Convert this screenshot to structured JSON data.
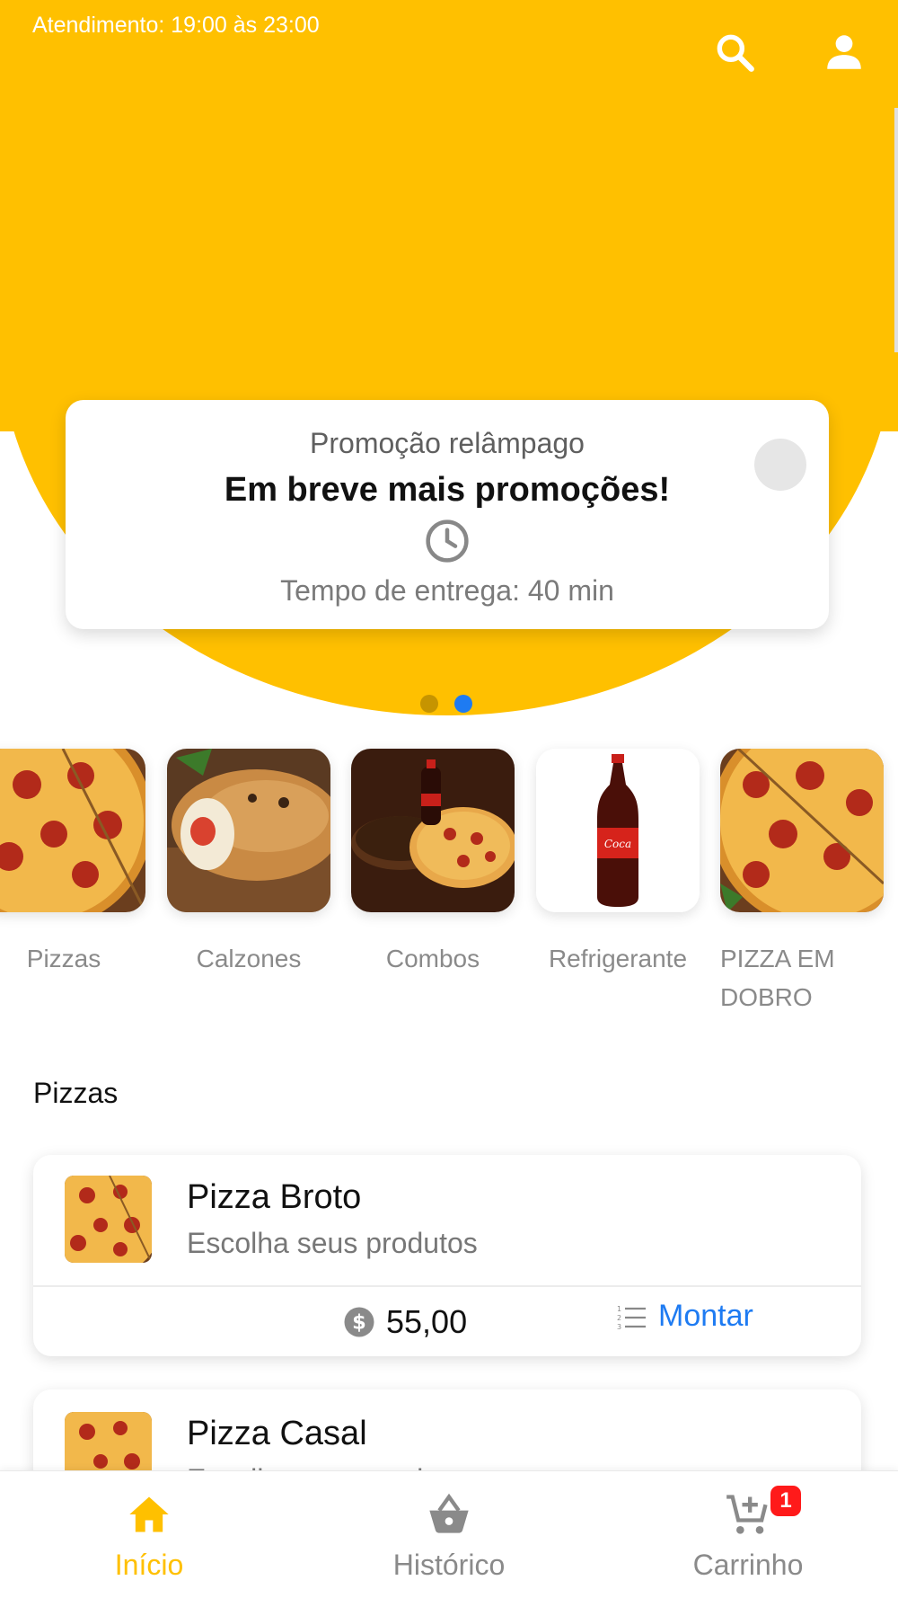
{
  "header": {
    "hours_text": "Atendimento: 19:00 às 23:00",
    "search_icon": "search-icon",
    "profile_icon": "user-icon"
  },
  "colors": {
    "brand_yellow": "#FFC000",
    "accent_blue": "#1E7BF2",
    "badge_red": "#FF1A1A"
  },
  "promo": {
    "subtitle": "Promoção relâmpago",
    "title": "Em breve mais promoções!",
    "clock_icon": "clock-icon",
    "delivery_time": "Tempo de entrega: 40 min",
    "carousel_active_index": 1
  },
  "categories": [
    {
      "label": "Pizzas"
    },
    {
      "label": "Calzones"
    },
    {
      "label": "Combos"
    },
    {
      "label": "Refrigerante"
    },
    {
      "label": "PIZZA EM DOBRO"
    }
  ],
  "section": {
    "title": "Pizzas"
  },
  "products": [
    {
      "name": "Pizza Broto",
      "description": "Escolha seus produtos",
      "price": "55,00",
      "action_label": "Montar"
    },
    {
      "name": "Pizza Casal",
      "description": "Escolha seus produtos"
    }
  ],
  "bottom_nav": {
    "home_label": "Início",
    "history_label": "Histórico",
    "cart_label": "Carrinho",
    "cart_badge": "1"
  }
}
